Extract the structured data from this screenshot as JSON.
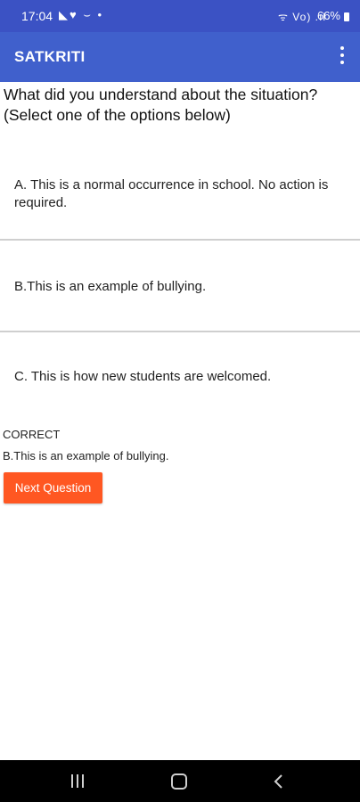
{
  "status_bar": {
    "time": "17:04",
    "left_icons": "◣♥ ⌣ •",
    "right_icons": "ᯤ Vo) .ıl",
    "battery": "66%"
  },
  "app_bar": {
    "title": "SATKRITI",
    "menu_icon": "more-vert-icon"
  },
  "question": {
    "text": "What did you understand about the situation? (Select one of the options below)"
  },
  "options": [
    {
      "label": "A. This is a normal occurrence in school. No action is required."
    },
    {
      "label": "B.This is an example of bullying."
    },
    {
      "label": "C. This is how new students are welcomed."
    }
  ],
  "result": {
    "status": "CORRECT",
    "answer": "B.This is an example of bullying."
  },
  "next_button": {
    "label": "Next Question",
    "color": "#ff5722"
  },
  "colors": {
    "app_bar": "#4060cc",
    "status_bar": "#3b52c4"
  },
  "nav_bar": {
    "recents_icon": "recents-icon",
    "home_icon": "home-icon",
    "back_icon": "back-icon"
  }
}
